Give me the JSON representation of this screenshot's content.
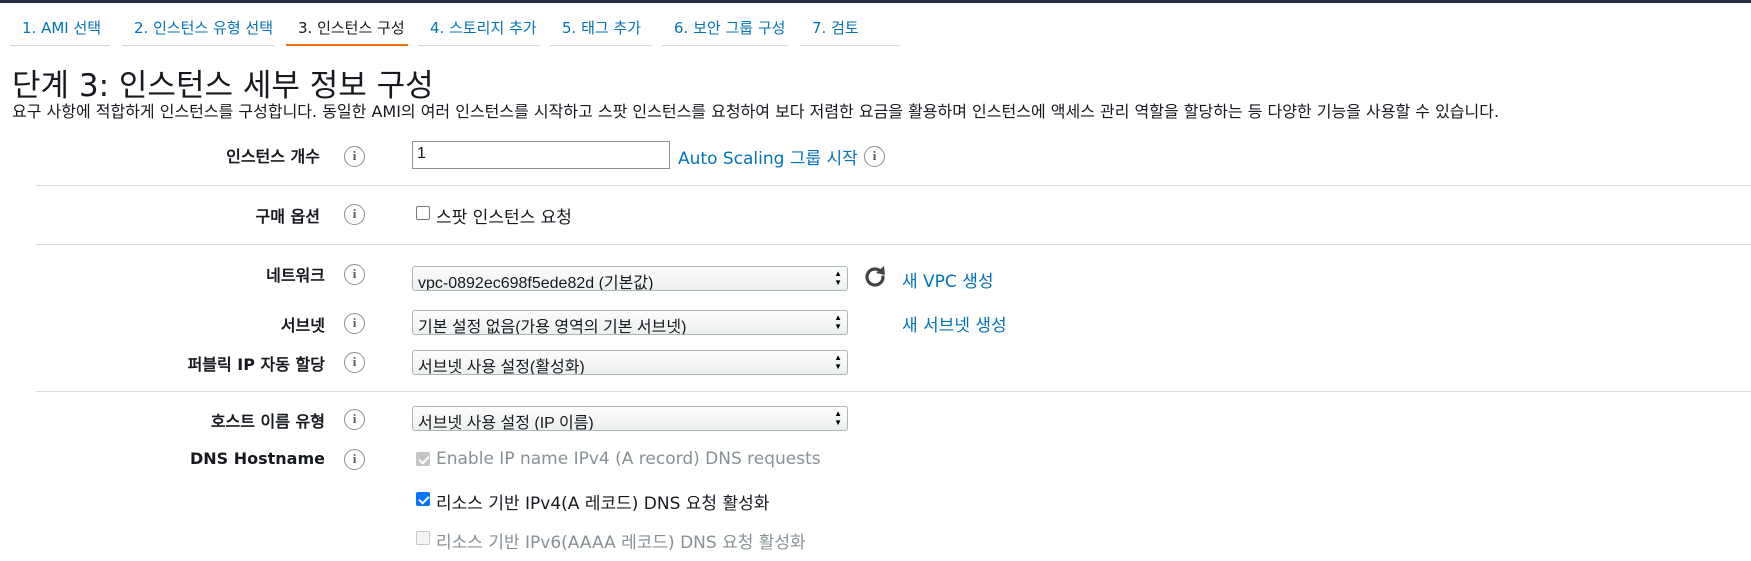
{
  "steps": [
    {
      "label": "1. AMI 선택"
    },
    {
      "label": "2. 인스턴스 유형 선택"
    },
    {
      "label": "3. 인스턴스 구성"
    },
    {
      "label": "4. 스토리지 추가"
    },
    {
      "label": "5. 태그 추가"
    },
    {
      "label": "6. 보안 그룹 구성"
    },
    {
      "label": "7. 검토"
    }
  ],
  "page": {
    "title": "단계 3: 인스턴스 세부 정보 구성",
    "description": "요구 사항에 적합하게 인스턴스를 구성합니다. 동일한 AMI의 여러 인스턴스를 시작하고 스팟 인스턴스를 요청하여 보다 저렴한 요금을 활용하며 인스턴스에 액세스 관리 역할을 할당하는 등 다양한 기능을 사용할 수 있습니다."
  },
  "info_glyph": "i",
  "instance_count": {
    "label": "인스턴스 개수",
    "value": "1",
    "asg_link": "Auto Scaling 그룹 시작"
  },
  "purchase": {
    "label": "구매 옵션",
    "spot_label": "스팟 인스턴스 요청",
    "spot_checked": false
  },
  "network": {
    "label": "네트워크",
    "value": "vpc-0892ec698f5ede82d (기본값)",
    "new_link": "새 VPC 생성"
  },
  "subnet": {
    "label": "서브넷",
    "value": "기본 설정 없음(가용 영역의 기본 서브넷)",
    "new_link": "새 서브넷 생성"
  },
  "public_ip": {
    "label": "퍼블릭 IP 자동 할당",
    "value": "서브넷 사용 설정(활성화)"
  },
  "hostname_type": {
    "label": "호스트 이름 유형",
    "value": "서브넷 사용 설정 (IP 이름)"
  },
  "dns_hostname": {
    "label": "DNS Hostname",
    "options": [
      {
        "label": "Enable IP name IPv4 (A record) DNS requests",
        "checked": true,
        "disabled": true
      },
      {
        "label": "리소스 기반 IPv4(A 레코드) DNS 요청 활성화",
        "checked": true,
        "disabled": false
      },
      {
        "label": "리소스 기반 IPv6(AAAA 레코드) DNS 요청 활성화",
        "checked": false,
        "disabled": true
      }
    ]
  },
  "colors": {
    "link": "#0073bb",
    "active_tab": "#ec7211",
    "header_bar": "#232f3e"
  },
  "icons": {
    "info": "info-circle-icon",
    "refresh": "refresh-icon",
    "select_arrows": "up-down-arrows-icon"
  }
}
